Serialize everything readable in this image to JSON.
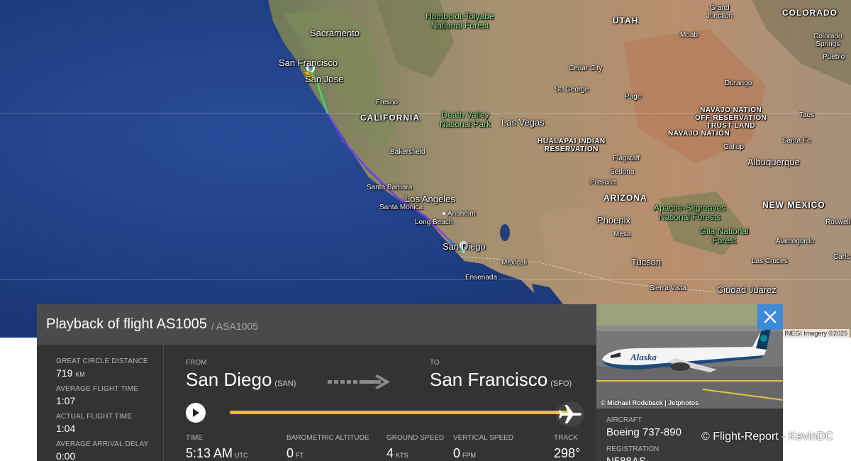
{
  "map": {
    "imagery_credit": "INEGI Imagery ©2025",
    "labels": {
      "grand_junction": "Grand\nJunction",
      "colorado": "COLORADO",
      "colorado_springs": "Colorado\nSprings",
      "pueblo": "Pueblo",
      "sacramento": "Sacramento",
      "humboldt": "Humboldt-Toiyabe\nNational Forest",
      "utah": "UTAH",
      "moab": "Moab",
      "durango": "Durango",
      "san_francisco": "San Francisco",
      "san_jose": "San Jose",
      "cedar_city": "Cedar City",
      "st_george": "St. George",
      "page": "Page",
      "fresno": "Fresno",
      "california": "CALIFORNIA",
      "death_valley": "Death Valley\nNational Park",
      "las_vegas": "Las Vegas",
      "navajo_otr": "NAVAJO NATION\nOFF-RESERVATION\nTRUST LAND",
      "taos": "Taos",
      "navajo": "NAVAJO NATION",
      "hualapai": "HUALAPAI INDIAN\nRESERVATION",
      "bakersfield": "Bakersfield",
      "flagstaff": "Flagstaff",
      "gallup": "Gallup",
      "santa_fe": "Santa Fe",
      "sedona": "Sedona",
      "albuquerque": "Albuquerque",
      "santa_barbara": "Santa Barbara",
      "prescott": "Prescott",
      "arizona": "ARIZONA",
      "los_angeles": "Los Angeles",
      "santa_monica": "Santa Monica",
      "anaheim": "Anaheim",
      "apache": "Apache-Sitgreaves\nNational Forests",
      "new_mexico": "NEW MEXICO",
      "long_beach": "Long Beach",
      "phoenix": "Phoenix",
      "mesa": "Mesa",
      "gila": "Gila National\nForest",
      "roswell": "Roswell",
      "alamogordo": "Alamogordo",
      "san_diego": "San Diego",
      "mexicali": "Mexicali",
      "tucson": "Tucson",
      "las_cruces": "Las Cruces",
      "carlsbad": "Carls",
      "ensenada": "Ensenada",
      "sierra_vista": "Sierra Vista",
      "ciudad_juarez": "Ciudad Juárez"
    }
  },
  "panel": {
    "title": "Playback of flight AS1005",
    "subtitle": "/ ASA1005",
    "stats": [
      {
        "label": "GREAT CIRCLE DISTANCE",
        "value": "719",
        "unit": "KM"
      },
      {
        "label": "AVERAGE FLIGHT TIME",
        "value": "1:07",
        "unit": ""
      },
      {
        "label": "ACTUAL FLIGHT TIME",
        "value": "1:04",
        "unit": ""
      },
      {
        "label": "AVERAGE ARRIVAL DELAY",
        "value": "0:00",
        "unit": ""
      }
    ],
    "from": {
      "label": "FROM",
      "city": "San Diego",
      "code": "(SAN)"
    },
    "to": {
      "label": "TO",
      "city": "San Francisco",
      "code": "(SFO)"
    },
    "progress": 1.0,
    "time": {
      "label": "TIME",
      "value": "5:13 AM",
      "unit": "UTC"
    },
    "altitude": {
      "label": "BAROMETRIC ALTITUDE",
      "value": "0",
      "unit": "FT"
    },
    "ground_speed": {
      "label": "GROUND SPEED",
      "value": "4",
      "unit": "KTS"
    },
    "vertical_speed": {
      "label": "VERTICAL SPEED",
      "value": "0",
      "unit": "FPM"
    },
    "track": {
      "label": "TRACK",
      "value": "298°"
    }
  },
  "aircraft": {
    "photo_credit": "© Michael Rodeback | Jetphotos",
    "livery_text": "Alaska",
    "aircraft_label": "AIRCRAFT",
    "aircraft_value": "Boeing 737-890",
    "registration_label": "REGISTRATION",
    "registration_value": "N588AS"
  },
  "watermark": "© Flight-Report - KevinDC",
  "colors": {
    "ocean": "#1f3f86",
    "panel": "#333335",
    "panel_header": "#4a4a4c",
    "progress": "#f3c01b",
    "close_button": "#3d8ad8"
  },
  "icons": [
    "play-icon",
    "plane-icon",
    "close-icon",
    "route-arrow-icon",
    "origin-marker-icon",
    "aircraft-marker-icon"
  ]
}
